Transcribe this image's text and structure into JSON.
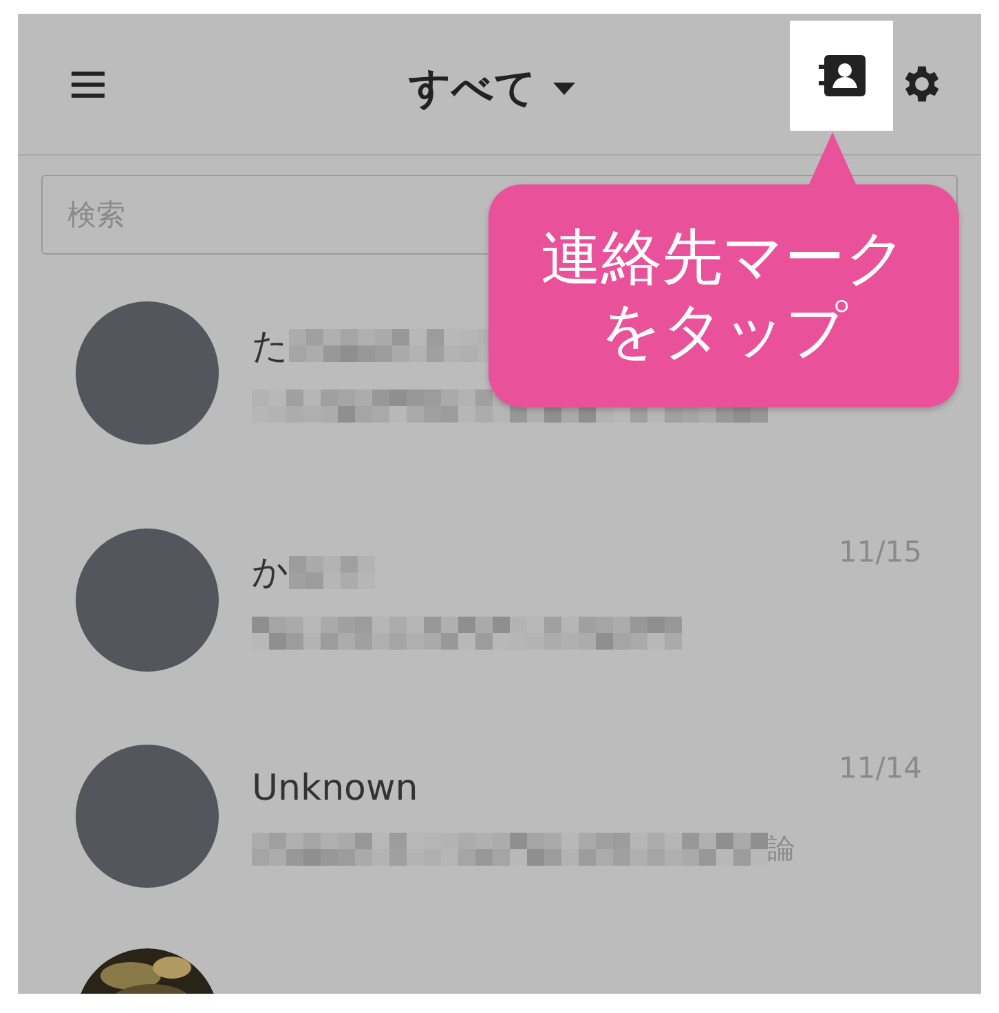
{
  "header": {
    "title": "すべて",
    "contacts_highlighted": true
  },
  "search": {
    "placeholder": "検索"
  },
  "callout": {
    "lines": [
      "連絡先マーク",
      "をタップ"
    ]
  },
  "chats": [
    {
      "kind": "plain",
      "name": "た",
      "name_pixelated": true,
      "message_pixelated": true
    },
    {
      "kind": "plain",
      "name": "か",
      "name_pixelated": true,
      "message_pixelated": true,
      "date": "11/15"
    },
    {
      "kind": "plain",
      "name": "Unknown",
      "name_pixelated": false,
      "message_pixelated": true,
      "message_end": "論",
      "date": "11/14"
    },
    {
      "kind": "picture"
    }
  ]
}
